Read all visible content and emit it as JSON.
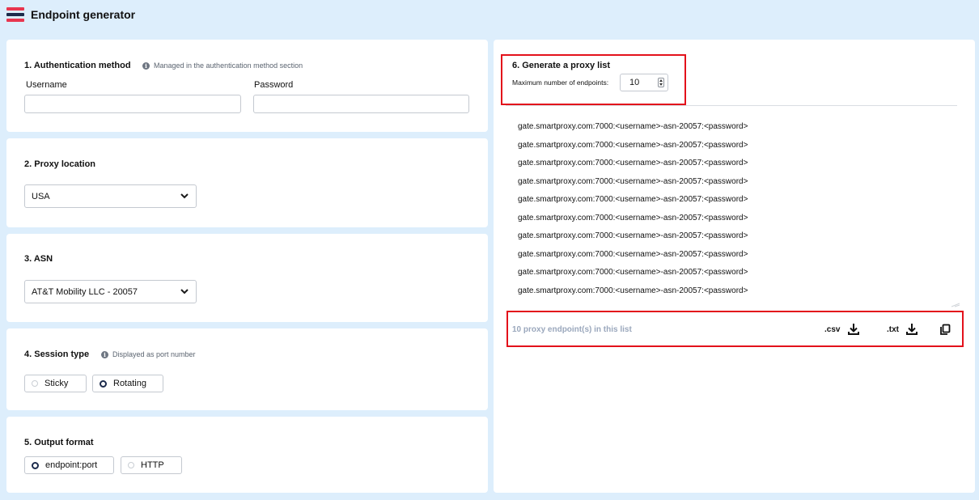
{
  "header": {
    "title": "Endpoint generator",
    "logo_icon": "stacked-bars-logo"
  },
  "auth": {
    "title": "1. Authentication method",
    "hint": "Managed in the authentication method section",
    "username_label": "Username",
    "username_value": "",
    "password_label": "Password",
    "password_value": ""
  },
  "location": {
    "title": "2. Proxy location",
    "selected": "USA"
  },
  "asn": {
    "title": "3. ASN",
    "selected": "AT&T Mobility LLC - 20057"
  },
  "session": {
    "title": "4. Session type",
    "hint": "Displayed as port number",
    "options": [
      {
        "label": "Sticky",
        "selected": false
      },
      {
        "label": "Rotating",
        "selected": true
      }
    ]
  },
  "output": {
    "title": "5. Output format",
    "options": [
      {
        "label": "endpoint:port",
        "selected": true
      },
      {
        "label": "HTTP",
        "selected": false
      }
    ]
  },
  "generate": {
    "title": "6. Generate a proxy list",
    "max_label": "Maximum number of endpoints:",
    "max_value": "10",
    "endpoints": [
      "gate.smartproxy.com:7000:<username>-asn-20057:<password>",
      "gate.smartproxy.com:7000:<username>-asn-20057:<password>",
      "gate.smartproxy.com:7000:<username>-asn-20057:<password>",
      "gate.smartproxy.com:7000:<username>-asn-20057:<password>",
      "gate.smartproxy.com:7000:<username>-asn-20057:<password>",
      "gate.smartproxy.com:7000:<username>-asn-20057:<password>",
      "gate.smartproxy.com:7000:<username>-asn-20057:<password>",
      "gate.smartproxy.com:7000:<username>-asn-20057:<password>",
      "gate.smartproxy.com:7000:<username>-asn-20057:<password>",
      "gate.smartproxy.com:7000:<username>-asn-20057:<password>"
    ],
    "count_text": "10 proxy endpoint(s) in this list",
    "csv_label": ".csv",
    "txt_label": ".txt"
  },
  "colors": {
    "background": "#ddeefc",
    "highlight": "#e3111b",
    "brand_red": "#e8364f",
    "brand_navy": "#1c2b4c"
  }
}
